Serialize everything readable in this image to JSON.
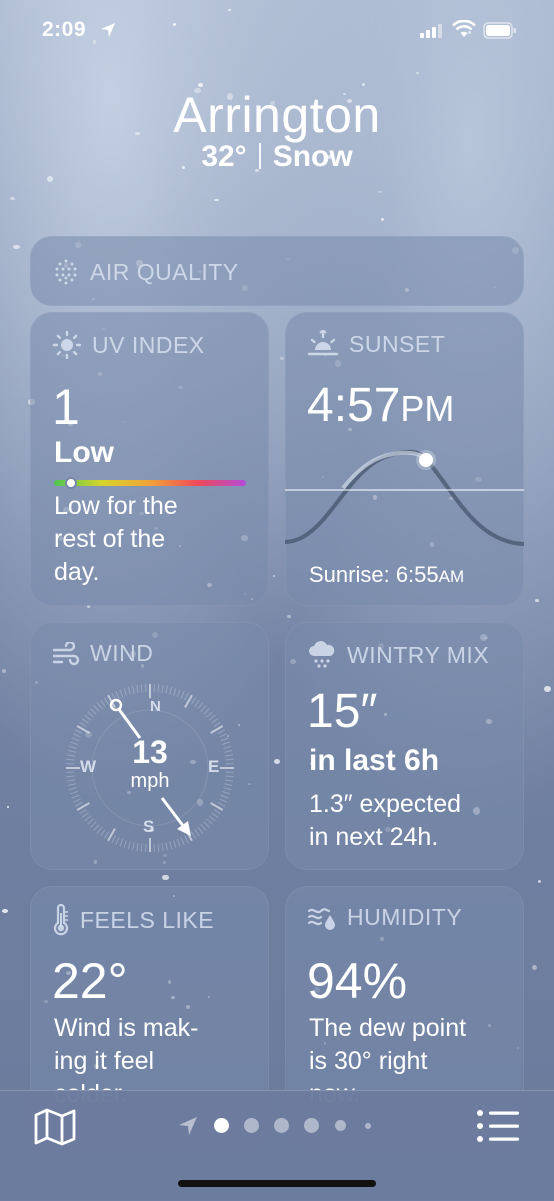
{
  "status_bar": {
    "time": "2:09"
  },
  "header": {
    "city": "Arrington",
    "temp": "32°",
    "condition": "Snow"
  },
  "air_quality": {
    "title": "AIR QUALITY"
  },
  "uv_index": {
    "title": "UV INDEX",
    "value": "1",
    "level": "Low",
    "description": "Low for the rest of the day.",
    "desc_lines": [
      "Low for the",
      "rest of the",
      "day."
    ],
    "scale_position_fraction": 0.09
  },
  "sunset": {
    "title": "SUNSET",
    "time_main": "4:57",
    "time_suffix": "PM",
    "sunrise_label": "Sunrise: 6:55",
    "sunrise_suffix": "AM"
  },
  "wind": {
    "title": "WIND",
    "speed": "13",
    "unit": "mph",
    "compass": {
      "n": "N",
      "s": "S",
      "e": "E",
      "w": "W"
    }
  },
  "wintry_mix": {
    "title": "WINTRY MIX",
    "amount": "15″",
    "period": "in last 6h",
    "forecast_lines": [
      "1.3″ expected",
      "in next 24h."
    ]
  },
  "feels_like": {
    "title": "FEELS LIKE",
    "value": "22°",
    "desc_lines": [
      "Wind is mak-",
      "ing it feel",
      "colder."
    ]
  },
  "humidity": {
    "title": "HUMIDITY",
    "value": "94%",
    "desc_lines": [
      "The dew point",
      "is 30° right",
      "now."
    ]
  },
  "bottom_bar": {
    "map_icon": "map-icon",
    "list_icon": "list-icon",
    "page_count": 6,
    "current_page": 1
  },
  "colors": {
    "accent_text": "#d7e1f0",
    "card_bg": "rgba(120,138,172,0.55)"
  }
}
